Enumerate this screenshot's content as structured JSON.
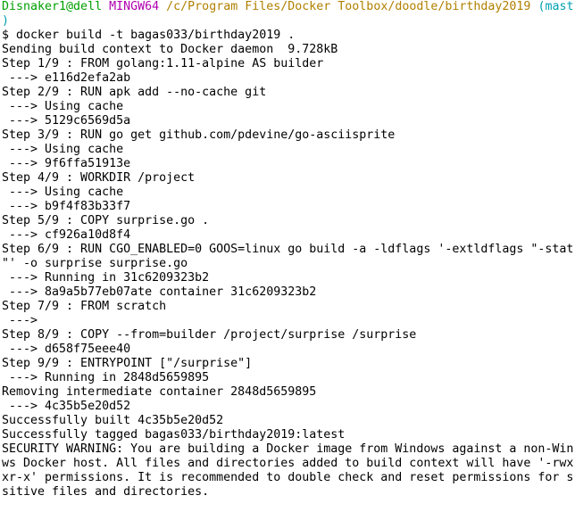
{
  "prompt": {
    "user_host": "Disnaker1@dell",
    "system": "MINGW64",
    "cwd": "/c/Program Files/Docker Toolbox/doodle/birthday2019",
    "branch_open": "(mast",
    "branch_close": ")"
  },
  "colors": {
    "user_host": "#00a000",
    "system": "#b000b0",
    "cwd": "#b08000",
    "branch": "#00a0b0",
    "text": "#000000",
    "background": "#ffffff"
  },
  "output_lines": [
    "$ docker build -t bagas033/birthday2019 .",
    "Sending build context to Docker daemon  9.728kB",
    "Step 1/9 : FROM golang:1.11-alpine AS builder",
    " ---> e116d2efa2ab",
    "Step 2/9 : RUN apk add --no-cache git",
    " ---> Using cache",
    " ---> 5129c6569d5a",
    "Step 3/9 : RUN go get github.com/pdevine/go-asciisprite",
    " ---> Using cache",
    " ---> 9f6ffa51913e",
    "Step 4/9 : WORKDIR /project",
    " ---> Using cache",
    " ---> b9f4f83b33f7",
    "Step 5/9 : COPY surprise.go .",
    " ---> cf926a10d8f4",
    "Step 6/9 : RUN CGO_ENABLED=0 GOOS=linux go build -a -ldflags '-extldflags \"-stat",
    "\"' -o surprise surprise.go",
    " ---> Running in 31c6209323b2",
    " ---> 8a9a5b77eb07ate container 31c6209323b2",
    "Step 7/9 : FROM scratch",
    " --->",
    "Step 8/9 : COPY --from=builder /project/surprise /surprise",
    " ---> d658f75eee40",
    "Step 9/9 : ENTRYPOINT [\"/surprise\"]",
    " ---> Running in 2848d5659895",
    "Removing intermediate container 2848d5659895",
    " ---> 4c35b5e20d52",
    "Successfully built 4c35b5e20d52",
    "Successfully tagged bagas033/birthday2019:latest",
    "SECURITY WARNING: You are building a Docker image from Windows against a non-Win",
    "ws Docker host. All files and directories added to build context will have '-rwx",
    "xr-x' permissions. It is recommended to double check and reset permissions for s",
    "sitive files and directories."
  ]
}
